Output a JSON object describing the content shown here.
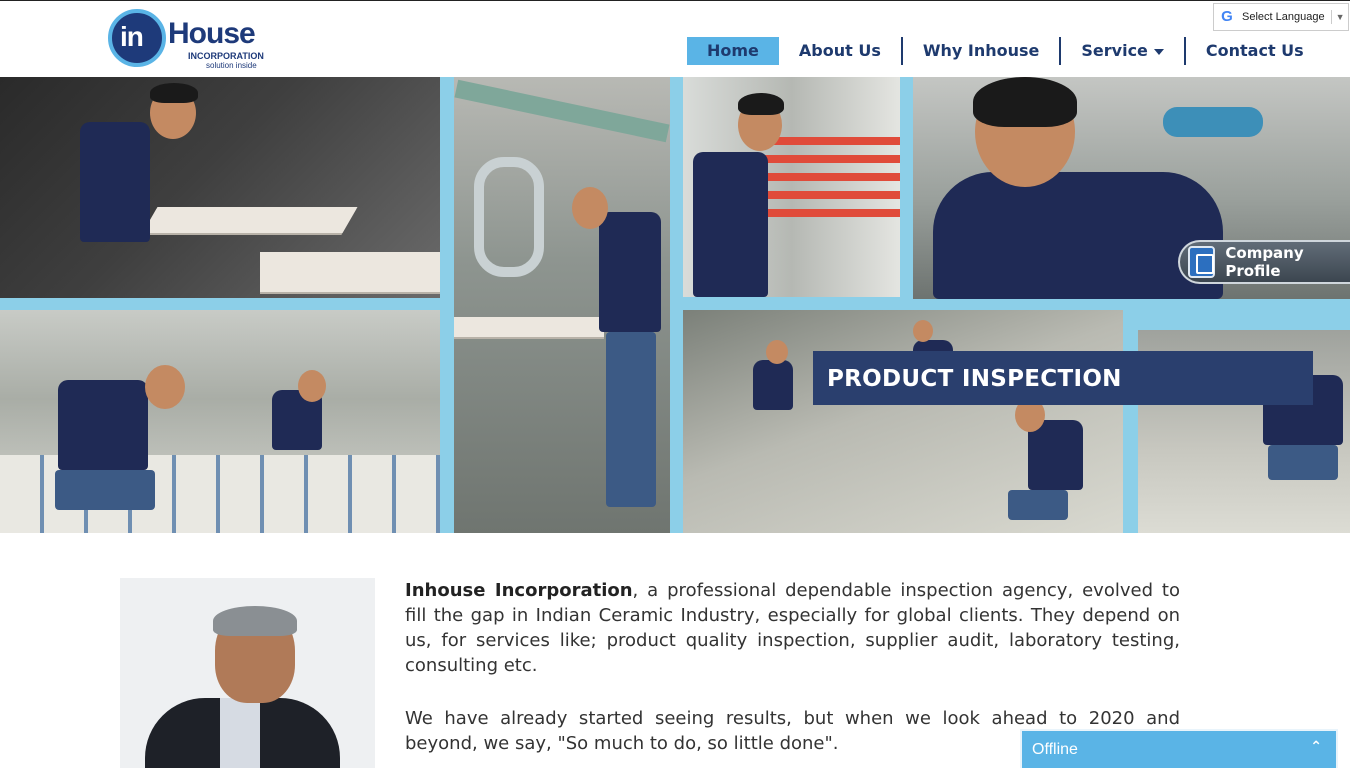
{
  "header": {
    "logo": {
      "mark": "in",
      "name": "House",
      "subtitle": "INCORPORATION",
      "tagline": "solution inside"
    },
    "nav": [
      {
        "label": "Home",
        "active": true
      },
      {
        "label": "About Us"
      },
      {
        "label": "Why Inhouse"
      },
      {
        "label": "Service",
        "has_dropdown": true
      },
      {
        "label": "Contact Us"
      }
    ],
    "translate": {
      "label": "Select Language",
      "icon": "google-g-icon"
    }
  },
  "banner": {
    "caption": "PRODUCT INSPECTION",
    "company_profile_label": "Company Profile"
  },
  "intro": {
    "lead_bold": "Inhouse Incorporation",
    "lead_rest": ", a professional dependable inspection agency, evolved to fill the gap in Indian Ceramic Industry, especially for global clients. They depend on us, for services like; product quality inspection, supplier audit, laboratory testing, consulting etc.",
    "paragraph2": "We have already started seeing results, but when we look ahead to 2020 and beyond, we say, \"So much to do, so little done\"."
  },
  "chat": {
    "status": "Offline"
  },
  "colors": {
    "navy": "#1e3a6e",
    "accent": "#5ab4e6",
    "caption_bg": "#2a3f6e"
  }
}
